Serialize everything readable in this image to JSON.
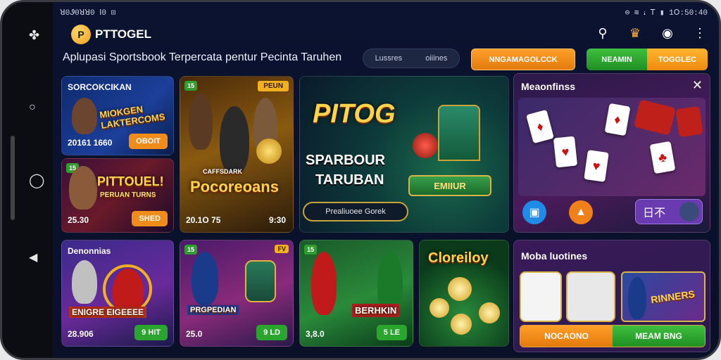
{
  "status": {
    "left": "ꓤ0Ꮽ0ꓤꓤ0 ꓲ0 ⊡",
    "right": "⊖ ≋ ꭵ ꓔ ▮ 1ꓳ:50:40"
  },
  "header": {
    "brand": "PTTOGEL",
    "brand_mark": "P"
  },
  "nav": {
    "tagline": "Aplupasi Sportsbook Terpercata   pentur  Pecinta    Taruhen",
    "pill_left": "Lussres",
    "pill_right": "oiiines",
    "orange_btn": "NNGAMAGOLCCK",
    "seg_a": "NEAMIN",
    "seg_b": "TOGGLEC"
  },
  "cards": {
    "c1": {
      "title": "SORCOKCIKAN",
      "big": "MIOKGEN LAKTERCOMS",
      "num": "20161 1660",
      "btn": "OBOIT"
    },
    "c2": {
      "badge": "15",
      "big": "PITTOUEL!",
      "sub": "PERUAN TURNS",
      "num": "25.30",
      "btn": "SHED"
    },
    "c3": {
      "badge": "15",
      "tag": "PEUN",
      "big": "Pocoreoans",
      "ribbon": "CAFFSDARK",
      "num": "20.1O 75",
      "num2": "9:30"
    },
    "hero": {
      "logo": "PITOG",
      "line1": "SPARBOUR",
      "line2": "TARUBAN",
      "sign": "EMIIUR",
      "btn": "Prealiuoee Gorek"
    },
    "c5": {
      "title": "Denonnias",
      "big": "ENIGRE  EIGEEEE",
      "num": "28.906",
      "btn": "9 HIT"
    },
    "c6": {
      "badge": "15",
      "badge2": "FV",
      "big": "PRGPEDIAN",
      "num": "25.0",
      "btn": "9 LD"
    },
    "c7": {
      "badge": "15",
      "big": "BERHKIN",
      "num": "3,8.0",
      "btn": "5 LE"
    },
    "c8": {
      "big": "Cloreiloy"
    }
  },
  "panel_top": {
    "title": "Meaonfinss",
    "close": "✕",
    "seg": "日不",
    "chip": "▣"
  },
  "panel_bottom": {
    "title": "Moba luotines",
    "banner": "RINNERS",
    "btn_a": "NOCAONO",
    "btn_b": "MEAM BNG"
  },
  "colors": {
    "accent": "#f08c1a",
    "green": "#2aa52e",
    "purple": "#5a2a8a"
  }
}
